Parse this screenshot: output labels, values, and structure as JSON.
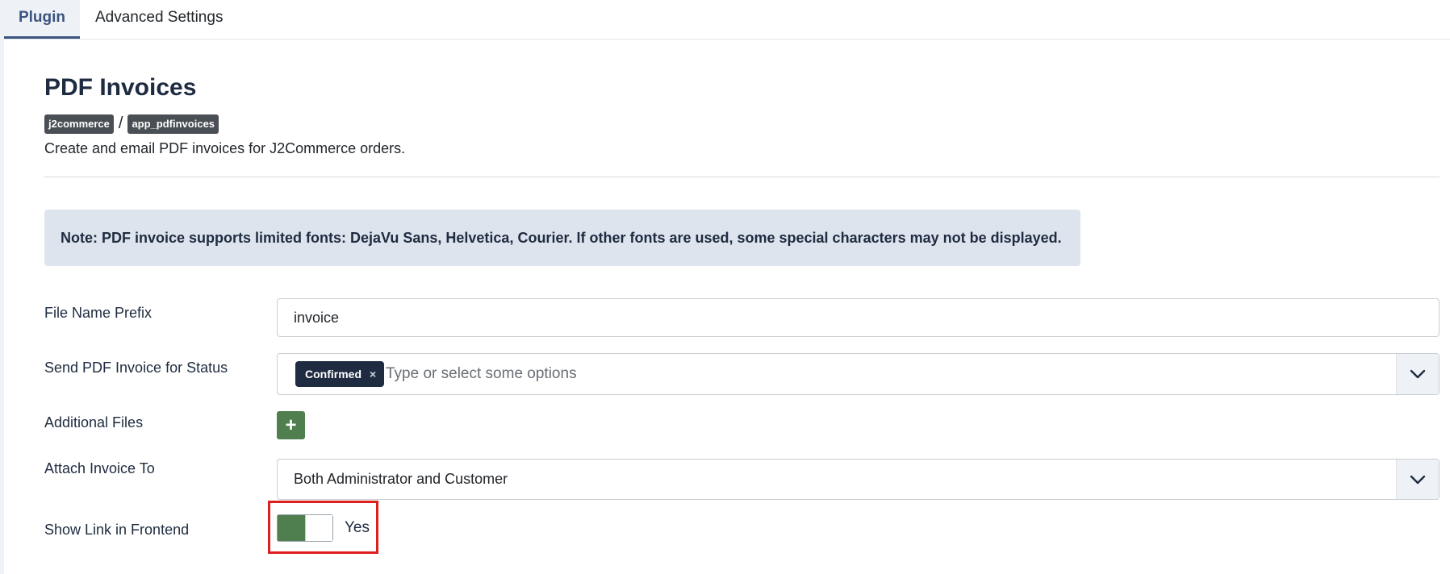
{
  "tabs": [
    {
      "label": "Plugin",
      "active": true
    },
    {
      "label": "Advanced Settings",
      "active": false
    }
  ],
  "header": {
    "title": "PDF Invoices",
    "breadcrumb": [
      "j2commerce",
      "app_pdfinvoices"
    ],
    "breadcrumb_separator": "/",
    "description": "Create and email PDF invoices for J2Commerce orders."
  },
  "note": {
    "text": "Note: PDF invoice supports limited fonts: DejaVu Sans, Helvetica, Courier. If other fonts are used, some special characters may not be displayed."
  },
  "form": {
    "file_name_prefix": {
      "label": "File Name Prefix",
      "value": "invoice"
    },
    "send_status": {
      "label": "Send PDF Invoice for Status",
      "selected": [
        "Confirmed"
      ],
      "remove_glyph": "×",
      "placeholder": "Type or select some options"
    },
    "additional_files": {
      "label": "Additional Files",
      "add_glyph": "+"
    },
    "attach_to": {
      "label": "Attach Invoice To",
      "value": "Both Administrator and Customer"
    },
    "show_link": {
      "label": "Show Link in Frontend",
      "value": "Yes",
      "on": true
    }
  },
  "colors": {
    "accent": "#3b5480",
    "navy": "#1e2b40",
    "success": "#4f7e4f",
    "note_bg": "#dee4ee",
    "highlight": "#dd1f1f"
  }
}
